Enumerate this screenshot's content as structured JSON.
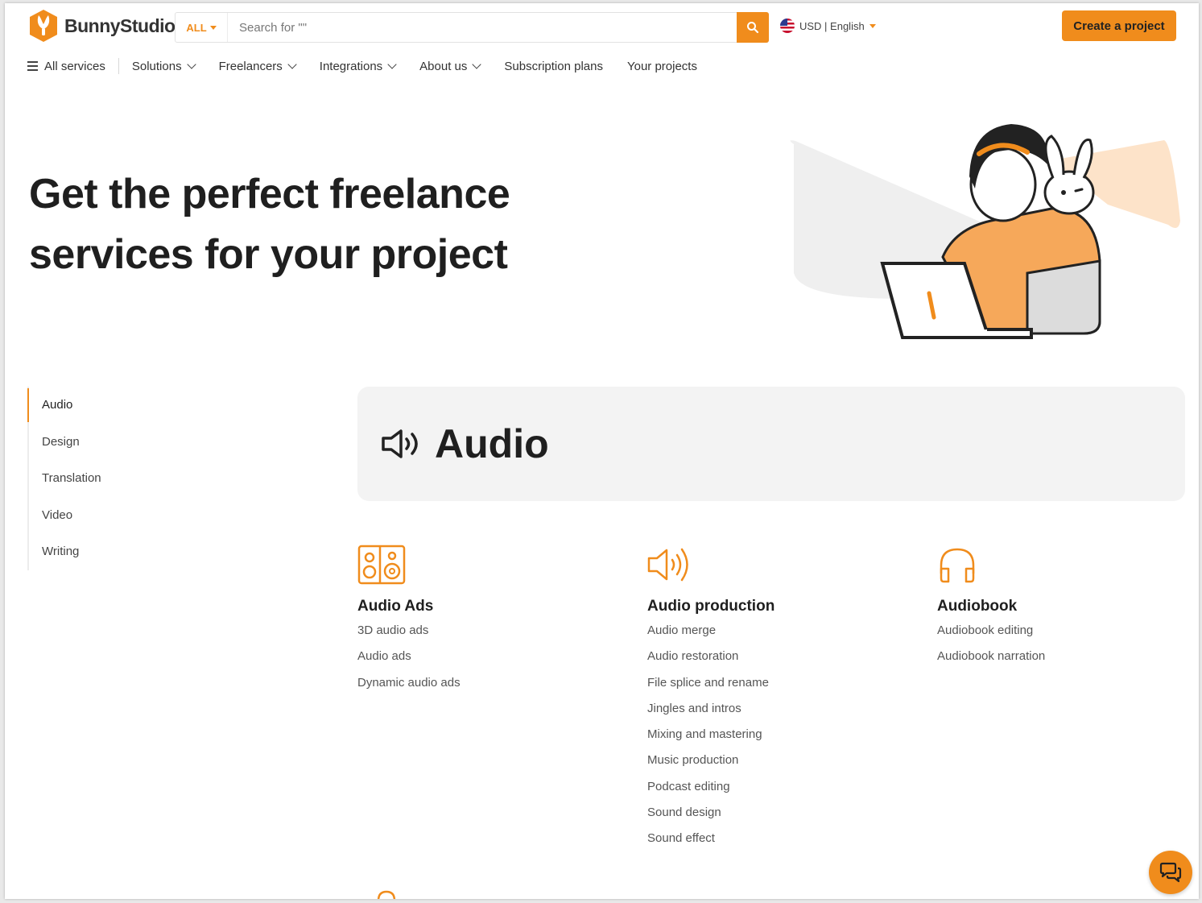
{
  "header": {
    "brand": "BunnyStudio",
    "search_scope": "ALL",
    "search_placeholder": "Search for \"\"",
    "locale": "USD | English",
    "create_label": "Create a project"
  },
  "nav": {
    "all_services": "All services",
    "items": [
      "Solutions",
      "Freelancers",
      "Integrations",
      "About us",
      "Subscription plans",
      "Your projects"
    ]
  },
  "hero": {
    "line1": "Get the perfect freelance",
    "line2": "services for your project"
  },
  "categories": [
    "Audio",
    "Design",
    "Translation",
    "Video",
    "Writing"
  ],
  "active_category": "Audio",
  "banner": {
    "title": "Audio"
  },
  "columns": [
    {
      "title": "Audio Ads",
      "icon": "speaker-box-icon",
      "links": [
        "3D audio ads",
        "Audio ads",
        "Dynamic audio ads"
      ]
    },
    {
      "title": "Audio production",
      "icon": "volume-icon",
      "links": [
        "Audio merge",
        "Audio restoration",
        "File splice and rename",
        "Jingles and intros",
        "Mixing and mastering",
        "Music production",
        "Podcast editing",
        "Sound design",
        "Sound effect"
      ]
    },
    {
      "title": "Audiobook",
      "icon": "headphones-icon",
      "links": [
        "Audiobook editing",
        "Audiobook narration"
      ]
    }
  ],
  "colors": {
    "accent": "#f08c1c",
    "banner_bg": "#f3f3f3"
  }
}
